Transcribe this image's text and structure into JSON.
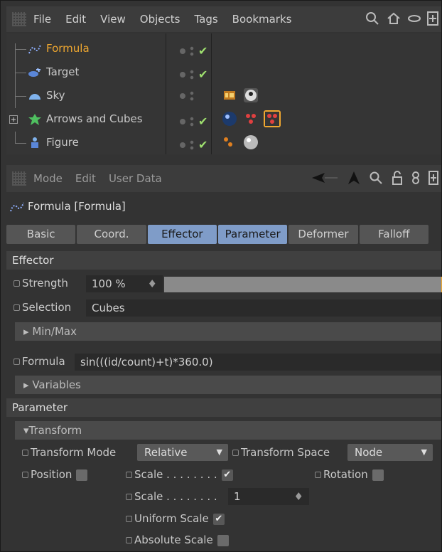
{
  "menu": {
    "items": [
      "File",
      "Edit",
      "View",
      "Objects",
      "Tags",
      "Bookmarks"
    ]
  },
  "objects": [
    {
      "name": "Formula",
      "active": true,
      "check": "✔"
    },
    {
      "name": "Target",
      "active": false,
      "check": "✔"
    },
    {
      "name": "Sky",
      "active": false,
      "check": ""
    },
    {
      "name": "Arrows and Cubes",
      "active": false,
      "check": "✔"
    },
    {
      "name": "Figure",
      "active": false,
      "check": "✔"
    }
  ],
  "attr_menu": {
    "items": [
      "Mode",
      "Edit",
      "User Data"
    ]
  },
  "attr_title": "Formula [Formula]",
  "tabs": [
    {
      "label": "Basic"
    },
    {
      "label": "Coord."
    },
    {
      "label": "Effector",
      "active": true
    },
    {
      "label": "Parameter",
      "active": true
    },
    {
      "label": "Deformer"
    },
    {
      "label": "Falloff"
    }
  ],
  "effector": {
    "section": "Effector",
    "strength_label": "Strength",
    "strength_value": "100 %",
    "strength_fraction": 1.0,
    "selection_label": "Selection",
    "selection_value": "Cubes",
    "minmax": "Min/Max",
    "formula_label": "Formula",
    "formula_value": "sin(((id/count)+t)*360.0)",
    "variables": "Variables"
  },
  "parameter": {
    "section": "Parameter",
    "transform": "Transform",
    "transform_mode_label": "Transform Mode",
    "transform_mode_value": "Relative",
    "transform_space_label": "Transform Space",
    "transform_space_value": "Node",
    "position_label": "Position",
    "scale_label": "Scale . . . . . . . .",
    "rotation_label": "Rotation",
    "scale2_label": "Scale . . . . . . . .",
    "scale2_value": "1",
    "uniform_scale_label": "Uniform Scale",
    "absolute_scale_label": "Absolute Scale"
  },
  "colors": {
    "accent": "#f0a830",
    "tab_active": "#7f9cc8",
    "check": "#9fe06f"
  }
}
